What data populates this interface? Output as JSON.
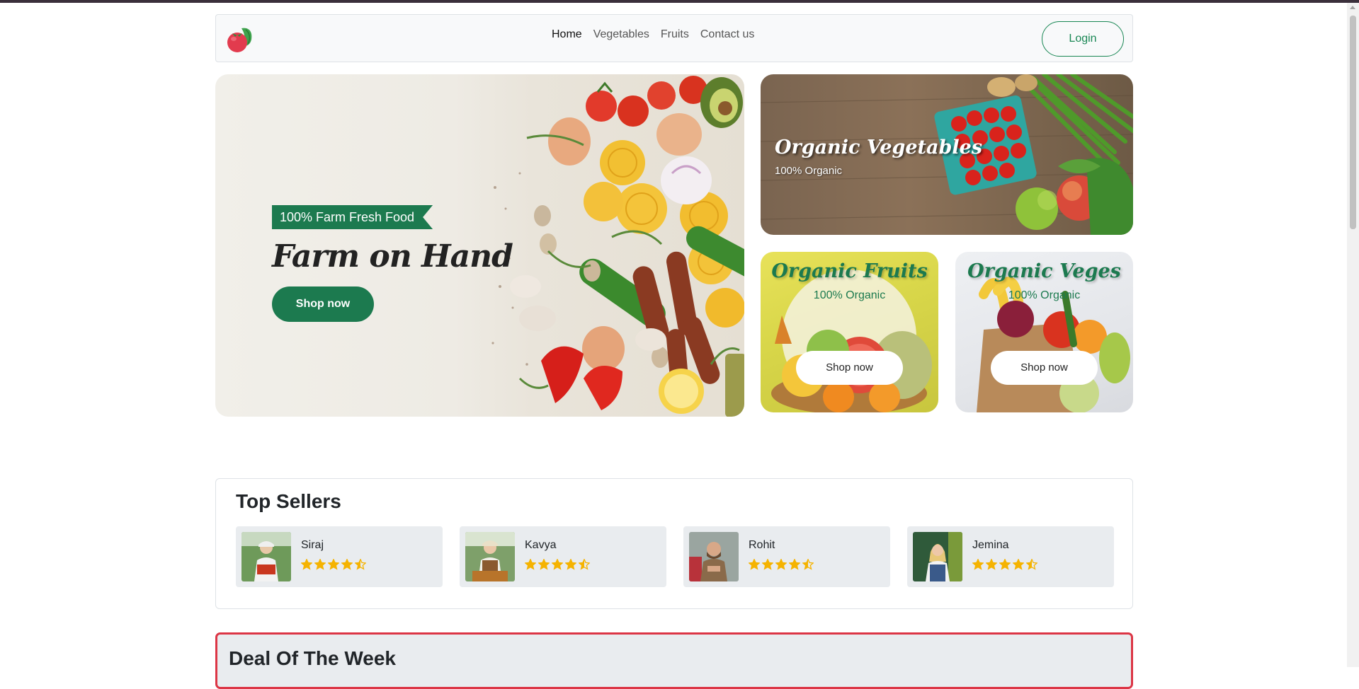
{
  "navbar": {
    "links": [
      "Home",
      "Vegetables",
      "Fruits",
      "Contact us"
    ],
    "login_label": "Login"
  },
  "hero": {
    "ribbon": "100% Farm Fresh Food",
    "title": "Farm on Hand",
    "button": "Shop now"
  },
  "cards": {
    "vegetables": {
      "title": "Organic Vegetables",
      "subtitle": "100% Organic"
    },
    "fruits": {
      "title": "Organic Fruits",
      "subtitle": "100% Organic",
      "button": "Shop now"
    },
    "veges": {
      "title": "Organic Veges",
      "subtitle": "100% Organic",
      "button": "Shop now"
    }
  },
  "top_sellers": {
    "title": "Top Sellers",
    "sellers": [
      {
        "name": "Siraj",
        "rating": 4.5
      },
      {
        "name": "Kavya",
        "rating": 4.5
      },
      {
        "name": "Rohit",
        "rating": 4.5
      },
      {
        "name": "Jemina",
        "rating": 4.5
      }
    ]
  },
  "deal": {
    "title": "Deal Of The Week"
  },
  "colors": {
    "brand_green": "#1c7a4f",
    "star": "#f5b301",
    "deal_border": "#dc3545"
  }
}
